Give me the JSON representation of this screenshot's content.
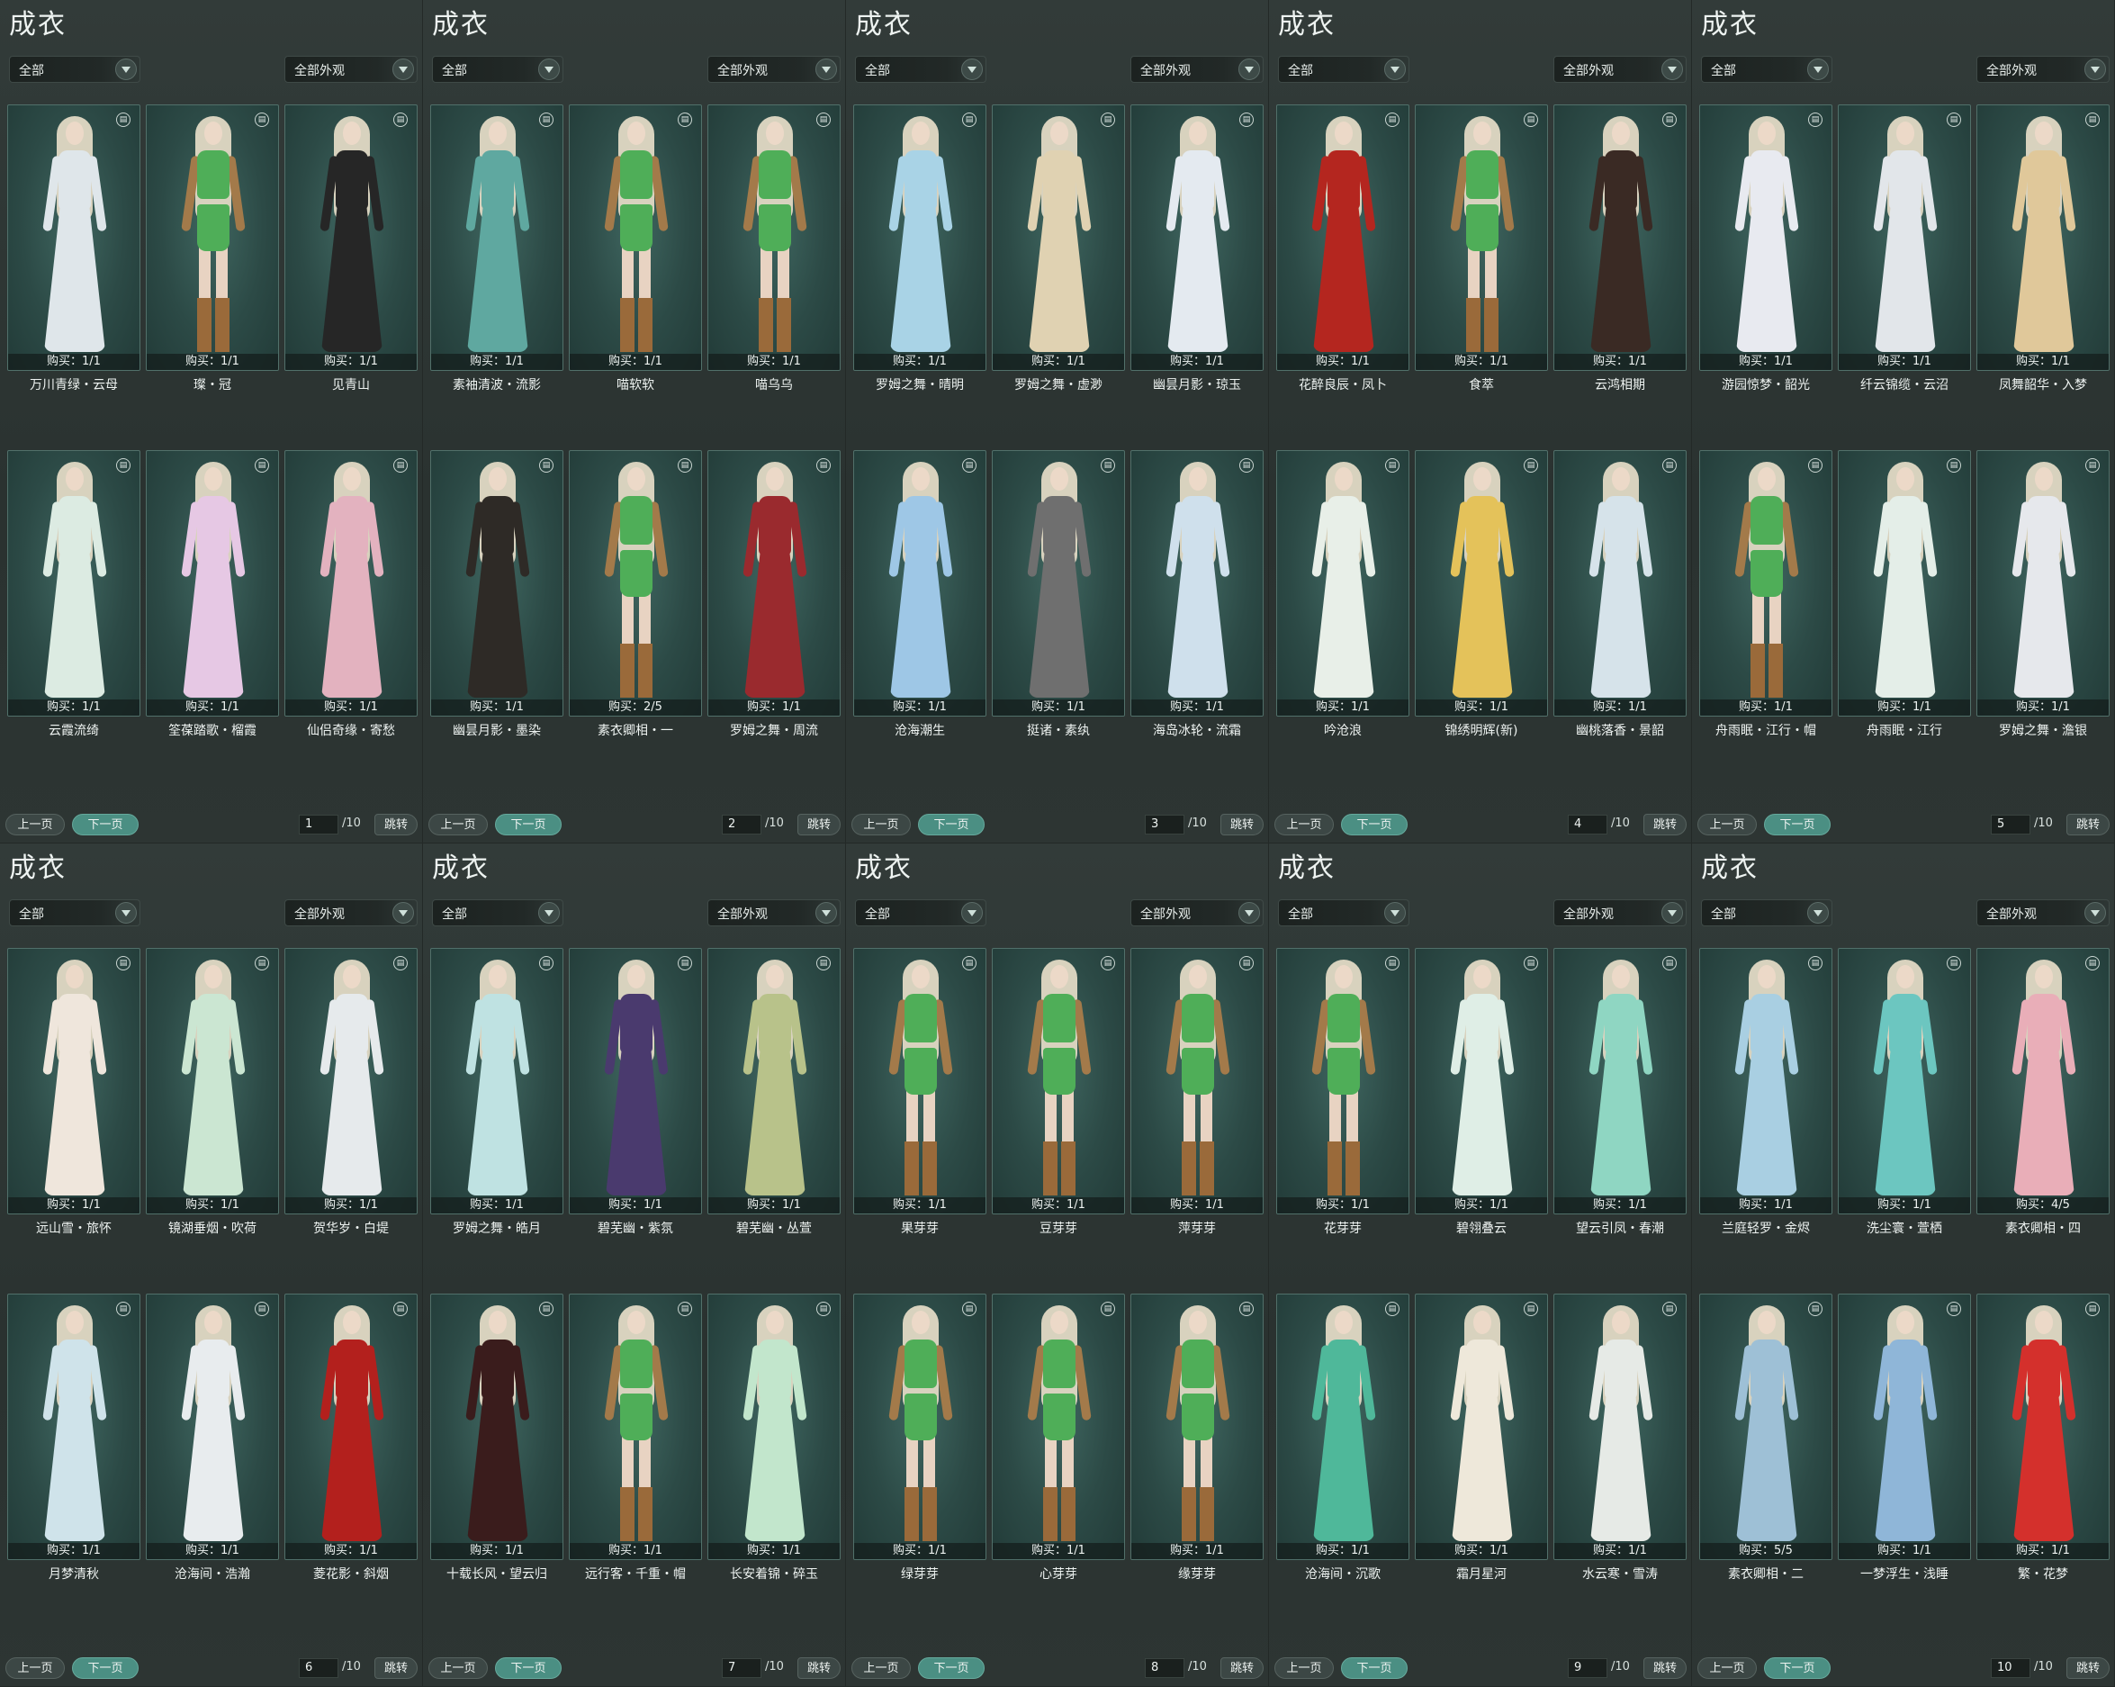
{
  "title": "成衣",
  "category_filter": "全部",
  "look_filter": "全部外观",
  "prev_label": "上一页",
  "next_label": "下一页",
  "jump_label": "跳转",
  "total_pages": "/10",
  "panels": [
    {
      "page": "1",
      "items": [
        {
          "name": "万川青绿・云母",
          "purchase": "购买：1/1",
          "style": "gown",
          "color": "#dfe6ea"
        },
        {
          "name": "璨・冠",
          "purchase": "购买：1/1",
          "style": "short",
          "color": "#4fae58"
        },
        {
          "name": "见青山",
          "purchase": "购买：1/1",
          "style": "gown",
          "color": "#262626"
        },
        {
          "name": "云霞流绮",
          "purchase": "购买：1/1",
          "style": "gown",
          "color": "#dcebe2"
        },
        {
          "name": "筌葆踏歌・榴霞",
          "purchase": "购买：1/1",
          "style": "gown",
          "color": "#e6c8e4"
        },
        {
          "name": "仙侣奇缘・寄愁",
          "purchase": "购买：1/1",
          "style": "gown",
          "color": "#e3b2bf"
        }
      ]
    },
    {
      "page": "2",
      "items": [
        {
          "name": "素袖清波・流影",
          "purchase": "购买：1/1",
          "style": "gown",
          "color": "#5fa8a0"
        },
        {
          "name": "喵软软",
          "purchase": "购买：1/1",
          "style": "short",
          "color": "#4fae58"
        },
        {
          "name": "喵乌乌",
          "purchase": "购买：1/1",
          "style": "short",
          "color": "#4fae58"
        },
        {
          "name": "幽昙月影・墨染",
          "purchase": "购买：1/1",
          "style": "gown",
          "color": "#2e2a26"
        },
        {
          "name": "素衣卿相・一",
          "purchase": "购买：2/5",
          "style": "short",
          "color": "#4fae58"
        },
        {
          "name": "罗姆之舞・周流",
          "purchase": "购买：1/1",
          "style": "gown",
          "color": "#9a2a2e"
        }
      ]
    },
    {
      "page": "3",
      "items": [
        {
          "name": "罗姆之舞・晴明",
          "purchase": "购买：1/1",
          "style": "gown",
          "color": "#a9d3e6"
        },
        {
          "name": "罗姆之舞・虚渺",
          "purchase": "购买：1/1",
          "style": "gown",
          "color": "#e0d2b2"
        },
        {
          "name": "幽昙月影・琼玉",
          "purchase": "购买：1/1",
          "style": "gown",
          "color": "#e4eaf0"
        },
        {
          "name": "沧海潮生",
          "purchase": "购买：1/1",
          "style": "gown",
          "color": "#9ec7e6"
        },
        {
          "name": "挺诸・素纨",
          "purchase": "购买：1/1",
          "style": "gown",
          "color": "#6f6f6f"
        },
        {
          "name": "海岛冰轮・流霜",
          "purchase": "购买：1/1",
          "style": "gown",
          "color": "#cfe0ec"
        }
      ]
    },
    {
      "page": "4",
      "items": [
        {
          "name": "花醉良辰・凤卜",
          "purchase": "购买：1/1",
          "style": "gown",
          "color": "#b4261f"
        },
        {
          "name": "食萃",
          "purchase": "购买：1/1",
          "style": "short",
          "color": "#4fae58"
        },
        {
          "name": "云鸿相期",
          "purchase": "购买：1/1",
          "style": "gown",
          "color": "#3a2a24"
        },
        {
          "name": "吟沧浪",
          "purchase": "购买：1/1",
          "style": "gown",
          "color": "#e8efe8"
        },
        {
          "name": "锦绣明辉(新)",
          "purchase": "购买：1/1",
          "style": "gown",
          "color": "#e4c25a"
        },
        {
          "name": "幽桃落香・景韶",
          "purchase": "购买：1/1",
          "style": "gown",
          "color": "#d6e3ea"
        }
      ]
    },
    {
      "page": "5",
      "items": [
        {
          "name": "游园惊梦・韶光",
          "purchase": "购买：1/1",
          "style": "gown",
          "color": "#e8eaf0"
        },
        {
          "name": "纤云锦缆・云沼",
          "purchase": "购买：1/1",
          "style": "gown",
          "color": "#e2e6ea"
        },
        {
          "name": "凤舞韶华・入梦",
          "purchase": "购买：1/1",
          "style": "gown",
          "color": "#e0c89a"
        },
        {
          "name": "舟雨眠・江行・帽",
          "purchase": "购买：1/1",
          "style": "short",
          "color": "#4fae58"
        },
        {
          "name": "舟雨眠・江行",
          "purchase": "购买：1/1",
          "style": "gown",
          "color": "#e4eee8"
        },
        {
          "name": "罗姆之舞・澹银",
          "purchase": "购买：1/1",
          "style": "gown",
          "color": "#e6e8ec"
        }
      ]
    },
    {
      "page": "6",
      "items": [
        {
          "name": "远山雪・旅怀",
          "purchase": "购买：1/1",
          "style": "gown",
          "color": "#efe6dc"
        },
        {
          "name": "镜湖垂烟・吹荷",
          "purchase": "购买：1/1",
          "style": "gown",
          "color": "#cbe6d2"
        },
        {
          "name": "贺华岁・白堤",
          "purchase": "购买：1/1",
          "style": "gown",
          "color": "#e6eaec"
        },
        {
          "name": "月梦清秋",
          "purchase": "购买：1/1",
          "style": "gown",
          "color": "#cfe3ea"
        },
        {
          "name": "沧海间・浩瀚",
          "purchase": "购买：1/1",
          "style": "gown",
          "color": "#e8ecee"
        },
        {
          "name": "菱花影・斜烟",
          "purchase": "购买：1/1",
          "style": "gown",
          "color": "#b3201d"
        }
      ]
    },
    {
      "page": "7",
      "items": [
        {
          "name": "罗姆之舞・皓月",
          "purchase": "购买：1/1",
          "style": "gown",
          "color": "#bfe2e2"
        },
        {
          "name": "碧芜幽・紫氛",
          "purchase": "购买：1/1",
          "style": "gown",
          "color": "#4a3a6e"
        },
        {
          "name": "碧芜幽・丛萱",
          "purchase": "购买：1/1",
          "style": "gown",
          "color": "#b8c28a"
        },
        {
          "name": "十载长风・望云归",
          "purchase": "购买：1/1",
          "style": "gown",
          "color": "#3a1c1c"
        },
        {
          "name": "远行客・千重・帽",
          "purchase": "购买：1/1",
          "style": "short",
          "color": "#4fae58"
        },
        {
          "name": "长安着锦・碎玉",
          "purchase": "购买：1/1",
          "style": "gown",
          "color": "#c2e6cc"
        }
      ]
    },
    {
      "page": "8",
      "items": [
        {
          "name": "果芽芽",
          "purchase": "购买：1/1",
          "style": "short",
          "color": "#4fae58"
        },
        {
          "name": "豆芽芽",
          "purchase": "购买：1/1",
          "style": "short",
          "color": "#4fae58"
        },
        {
          "name": "萍芽芽",
          "purchase": "购买：1/1",
          "style": "short",
          "color": "#4fae58"
        },
        {
          "name": "绿芽芽",
          "purchase": "购买：1/1",
          "style": "short",
          "color": "#4fae58"
        },
        {
          "name": "心芽芽",
          "purchase": "购买：1/1",
          "style": "short",
          "color": "#4fae58"
        },
        {
          "name": "缘芽芽",
          "purchase": "购买：1/1",
          "style": "short",
          "color": "#4fae58"
        }
      ]
    },
    {
      "page": "9",
      "items": [
        {
          "name": "花芽芽",
          "purchase": "购买：1/1",
          "style": "short",
          "color": "#4fae58"
        },
        {
          "name": "碧翎叠云",
          "purchase": "购买：1/1",
          "style": "gown",
          "color": "#dfeee6"
        },
        {
          "name": "望云引凤・春潮",
          "purchase": "购买：1/1",
          "style": "gown",
          "color": "#8fd6c2"
        },
        {
          "name": "沧海间・沉歌",
          "purchase": "购买：1/1",
          "style": "gown",
          "color": "#4fb89a"
        },
        {
          "name": "霜月星河",
          "purchase": "购买：1/1",
          "style": "gown",
          "color": "#eee8da"
        },
        {
          "name": "水云寒・雪涛",
          "purchase": "购买：1/1",
          "style": "gown",
          "color": "#e6eae6"
        }
      ]
    },
    {
      "page": "10",
      "items": [
        {
          "name": "兰庭轻罗・金烬",
          "purchase": "购买：1/1",
          "style": "gown",
          "color": "#a9cfe2"
        },
        {
          "name": "洗尘寰・萱栖",
          "purchase": "购买：1/1",
          "style": "gown",
          "color": "#6cc6c0"
        },
        {
          "name": "素衣卿相・四",
          "purchase": "购买：4/5",
          "style": "gown",
          "color": "#e9aeb8"
        },
        {
          "name": "素衣卿相・二",
          "purchase": "购买：5/5",
          "style": "gown",
          "color": "#9ec0d6"
        },
        {
          "name": "一梦浮生・浅睡",
          "purchase": "购买：1/1",
          "style": "gown",
          "color": "#8fb6d8"
        },
        {
          "name": "繁・花梦",
          "purchase": "购买：1/1",
          "style": "gown",
          "color": "#d4302c"
        }
      ]
    }
  ]
}
